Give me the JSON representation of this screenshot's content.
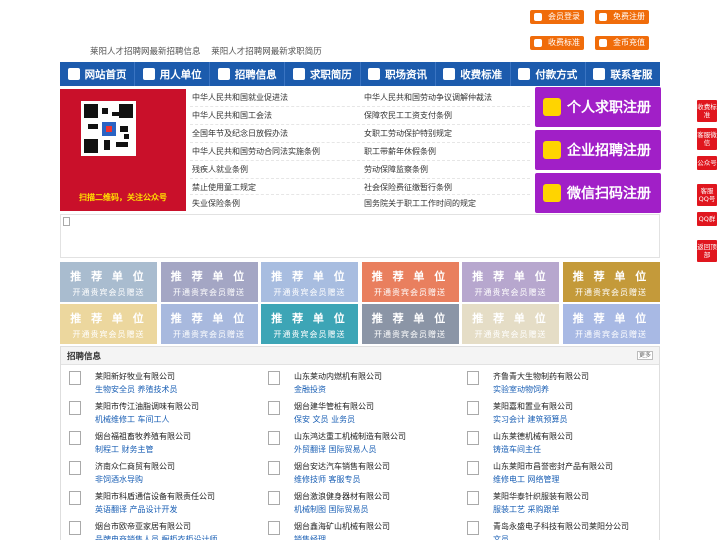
{
  "header": {
    "links": [
      "莱阳人才招聘网最新招聘信息",
      "莱阳人才招聘网最新求职简历"
    ],
    "buttons": {
      "member_login": "会员登录",
      "free_register": "免费注册",
      "fee_standard": "收费标准",
      "coin_recharge": "金币充值"
    },
    "button_color": "#f06c0a"
  },
  "nav": {
    "color": "#1c5bad",
    "items": [
      {
        "label": "网站首页",
        "icon": "home-icon"
      },
      {
        "label": "用人单位",
        "icon": "building-icon"
      },
      {
        "label": "招聘信息",
        "icon": "megaphone-icon"
      },
      {
        "label": "求职简历",
        "icon": "resume-icon"
      },
      {
        "label": "职场资讯",
        "icon": "news-icon"
      },
      {
        "label": "收费标准",
        "icon": "price-icon"
      },
      {
        "label": "付款方式",
        "icon": "card-icon"
      },
      {
        "label": "联系客服",
        "icon": "phone-icon"
      }
    ]
  },
  "qr": {
    "caption": "扫描二维码，关注公众号"
  },
  "laws": {
    "left": [
      "中华人民共和国就业促进法",
      "中华人民共和国工会法",
      "全国年节及纪念日放假办法",
      "中华人民共和国劳动合同法实施条例",
      "残疾人就业条例",
      "禁止使用童工规定",
      "失业保险条例"
    ],
    "right": [
      "中华人民共和国劳动争议调解仲裁法",
      "保障农民工工资支付条例",
      "女职工劳动保护特别规定",
      "职工带薪年休假条例",
      "劳动保障监察条例",
      "社会保险费征缴暂行条例",
      "国务院关于职工工作时间的规定"
    ]
  },
  "register": {
    "color": "#a11fc7",
    "items": [
      "个人求职注册",
      "企业招聘注册",
      "微信扫码注册"
    ]
  },
  "recommend": {
    "title": "推 荐 单 位",
    "subtitle": "开通贵宾会员赠送",
    "colors": [
      "#a9bccf",
      "#a4a6c4",
      "#a8bde0",
      "#e97f5e",
      "#b7a7ce",
      "#c49a3a",
      "#ecd79e",
      "#a8b9de",
      "#3da5b6",
      "#8b95a6",
      "#e5ddc6",
      "#a8b9e4"
    ]
  },
  "jobs": {
    "title": "招聘信息",
    "more": "更多",
    "columns": [
      [
        {
          "company": "莱阳新好牧业有限公司",
          "positions": "生物安全员 养殖技术员"
        },
        {
          "company": "莱阳市传江油脂调味有限公司",
          "positions": "机械维修工 车间工人"
        },
        {
          "company": "烟台福祖畜牧养殖有限公司",
          "positions": "制程工 财务主管"
        },
        {
          "company": "济南众仁商贸有限公司",
          "positions": "非饲酒水导购"
        },
        {
          "company": "莱阳市科盾通信设备有限责任公司",
          "positions": "英语翻译 产品设计开发"
        },
        {
          "company": "烟台市欧帝亚家居有限公司",
          "positions": "品牌电商销售人员 橱柜衣柜设计师"
        }
      ],
      [
        {
          "company": "山东莱动内燃机有限公司",
          "positions": "金融投资"
        },
        {
          "company": "烟台建华管桩有限公司",
          "positions": "保安 文员 业务员"
        },
        {
          "company": "山东鸿达重工机械制造有限公司",
          "positions": "外贸翻译 国际贸易人员"
        },
        {
          "company": "烟台安达汽车销售有限公司",
          "positions": "维修技师 客服专员"
        },
        {
          "company": "烟台激浪健身器材有限公司",
          "positions": "机械制图 国际贸易员"
        },
        {
          "company": "烟台鑫海矿山机械有限公司",
          "positions": "销售经理"
        }
      ],
      [
        {
          "company": "齐鲁青大生物制药有限公司",
          "positions": "实验室动物饲养"
        },
        {
          "company": "莱阳嘉和置业有限公司",
          "positions": "实习会计 建筑预算员"
        },
        {
          "company": "山东莱德机械有限公司",
          "positions": "铸造车间主任"
        },
        {
          "company": "山东莱阳市昌誉密封产品有限公司",
          "positions": "维修电工 网络管理"
        },
        {
          "company": "莱阳华泰针织服装有限公司",
          "positions": "服装工艺 采购跟单"
        },
        {
          "company": "青岛永盛电子科技有限公司莱阳分公司",
          "positions": "文员"
        }
      ]
    ]
  },
  "side_float": {
    "color": "#e0161e",
    "items": [
      "收费标准",
      "客服微信",
      "公众号",
      "客服QQ号",
      "QQ群",
      "返回顶部"
    ]
  }
}
